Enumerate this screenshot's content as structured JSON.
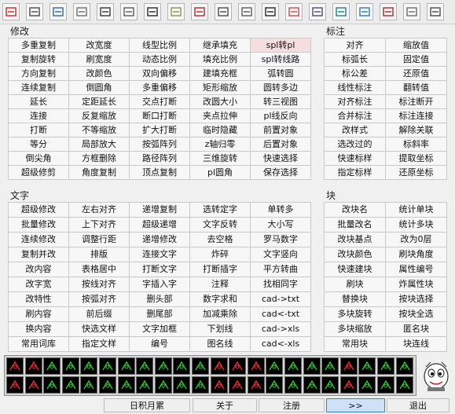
{
  "toolbar": {
    "icons": [
      "copy-icon",
      "printer-icon",
      "export-icon",
      "lock-icon",
      "layer-icon",
      "window-icon",
      "zoom-icon",
      "dimension-icon",
      "hatch-icon",
      "move-icon",
      "layout-icon",
      "arrow-icon",
      "palette-icon",
      "edit-icon",
      "calculator-icon",
      "eraser-icon",
      "magnet-icon",
      "settings-icon",
      "keyboard-icon"
    ]
  },
  "modify": {
    "title": "修改",
    "rows": [
      [
        "多重复制",
        "改宽度",
        "线型比例",
        "继承填充",
        "spl转pl"
      ],
      [
        "复制旋转",
        "刷宽度",
        "动态比例",
        "填充比例",
        "spl转线路"
      ],
      [
        "方向复制",
        "改颜色",
        "双向偏移",
        "建填充框",
        "弧转圆"
      ],
      [
        "连续复制",
        "倒圆角",
        "多重偏移",
        "矩形缩放",
        "圆转多边"
      ],
      [
        "延长",
        "定距延长",
        "交点打断",
        "改圆大小",
        "转三视图"
      ],
      [
        "连接",
        "反复缩放",
        "断口打断",
        "夹点拉伸",
        "pl线反向"
      ],
      [
        "打断",
        "不等缩放",
        "扩大打断",
        "临时隐藏",
        "前置对象"
      ],
      [
        "等分",
        "局部放大",
        "按弧阵列",
        "z轴归零",
        "后置对象"
      ],
      [
        "倒尖角",
        "方框删除",
        "路径阵列",
        "三维旋转",
        "快速选择"
      ],
      [
        "超级修剪",
        "角度复制",
        "顶点复制",
        "pl圆角",
        "保存选择"
      ]
    ],
    "highlight": "spl转pl"
  },
  "dimension": {
    "title": "标注",
    "rows": [
      [
        "对齐",
        "缩放值"
      ],
      [
        "标弧长",
        "固定值"
      ],
      [
        "标公差",
        "还原值"
      ],
      [
        "线性标注",
        "翻转值"
      ],
      [
        "对齐标注",
        "标注断开"
      ],
      [
        "合并标注",
        "标注连接"
      ],
      [
        "改样式",
        "解除关联"
      ],
      [
        "选改过的",
        "标斜率"
      ],
      [
        "快速标样",
        "提取坐标"
      ],
      [
        "指定标样",
        "还原坐标"
      ]
    ]
  },
  "text": {
    "title": "文字",
    "rows": [
      [
        "超级修改",
        "左右对齐",
        "递增复制",
        "选转定字",
        "单转多"
      ],
      [
        "批量修改",
        "上下对齐",
        "超级递增",
        "文字反转",
        "大小写"
      ],
      [
        "连续修改",
        "调整行距",
        "递增修改",
        "去空格",
        "罗马数字"
      ],
      [
        "复制并改",
        "排版",
        "连接文字",
        "炸碎",
        "文字竖向"
      ],
      [
        "改内容",
        "表格居中",
        "打断文字",
        "打断插字",
        "平方转曲"
      ],
      [
        "改字宽",
        "按线对齐",
        "字插入字",
        "注释",
        "找相同字"
      ],
      [
        "改特性",
        "按弧对齐",
        "删头部",
        "数字求和",
        "cad->txt"
      ],
      [
        "刷内容",
        "前后缀",
        "删尾部",
        "加减乘除",
        "cad<-txt"
      ],
      [
        "换内容",
        "快选文样",
        "文字加框",
        "下划线",
        "cad->xls"
      ],
      [
        "常用词库",
        "指定文样",
        "编号",
        "图名线",
        "cad<-xls"
      ]
    ]
  },
  "block": {
    "title": "块",
    "rows": [
      [
        "改块名",
        "统计单块"
      ],
      [
        "批量改名",
        "统计多块"
      ],
      [
        "改块基点",
        "改为0层"
      ],
      [
        "改块颜色",
        "刷块角度"
      ],
      [
        "快速建块",
        "属性编号"
      ],
      [
        "刷块",
        "炸属性块"
      ],
      [
        "替换块",
        "按块选择"
      ],
      [
        "多块旋转",
        "按块全选"
      ],
      [
        "多块缩放",
        "匿名块"
      ],
      [
        "常用块",
        "块连线"
      ]
    ]
  },
  "iconstrip": {
    "row1": [
      "square-icon",
      "crosshair-icon",
      "arrow-icon",
      "tick-icon",
      "lamp-icon",
      "bracket-icon",
      "leader-icon",
      "zigzag-icon",
      "box-icon",
      "wave-icon",
      "bubble-icon",
      "arrowhead-icon",
      "frame-icon",
      "slash-icon",
      "curve-icon",
      "chevron-icon",
      "rise-icon",
      "up-arrow-icon",
      "dot-icon",
      "tree-icon",
      "grass-icon",
      "line-icon"
    ],
    "row2": [
      "wave2-icon",
      "coil-icon",
      "ring-icon",
      "target-icon",
      "tree2-icon",
      "fence-icon",
      "bracket2-icon",
      "arrow2-icon",
      "dashed-icon",
      "bolt-icon",
      "cross-icon",
      "triangle-icon",
      "diamond-icon",
      "step-icon",
      "bars-icon",
      "half-icon",
      "dot2-icon",
      "ring2-icon",
      "mesh-icon",
      "chart-icon",
      "bar-icon",
      "sign-icon"
    ]
  },
  "footer": {
    "buttons": [
      "日积月累",
      "关于",
      "注册",
      ">>",
      "退出"
    ],
    "active": ">>"
  }
}
